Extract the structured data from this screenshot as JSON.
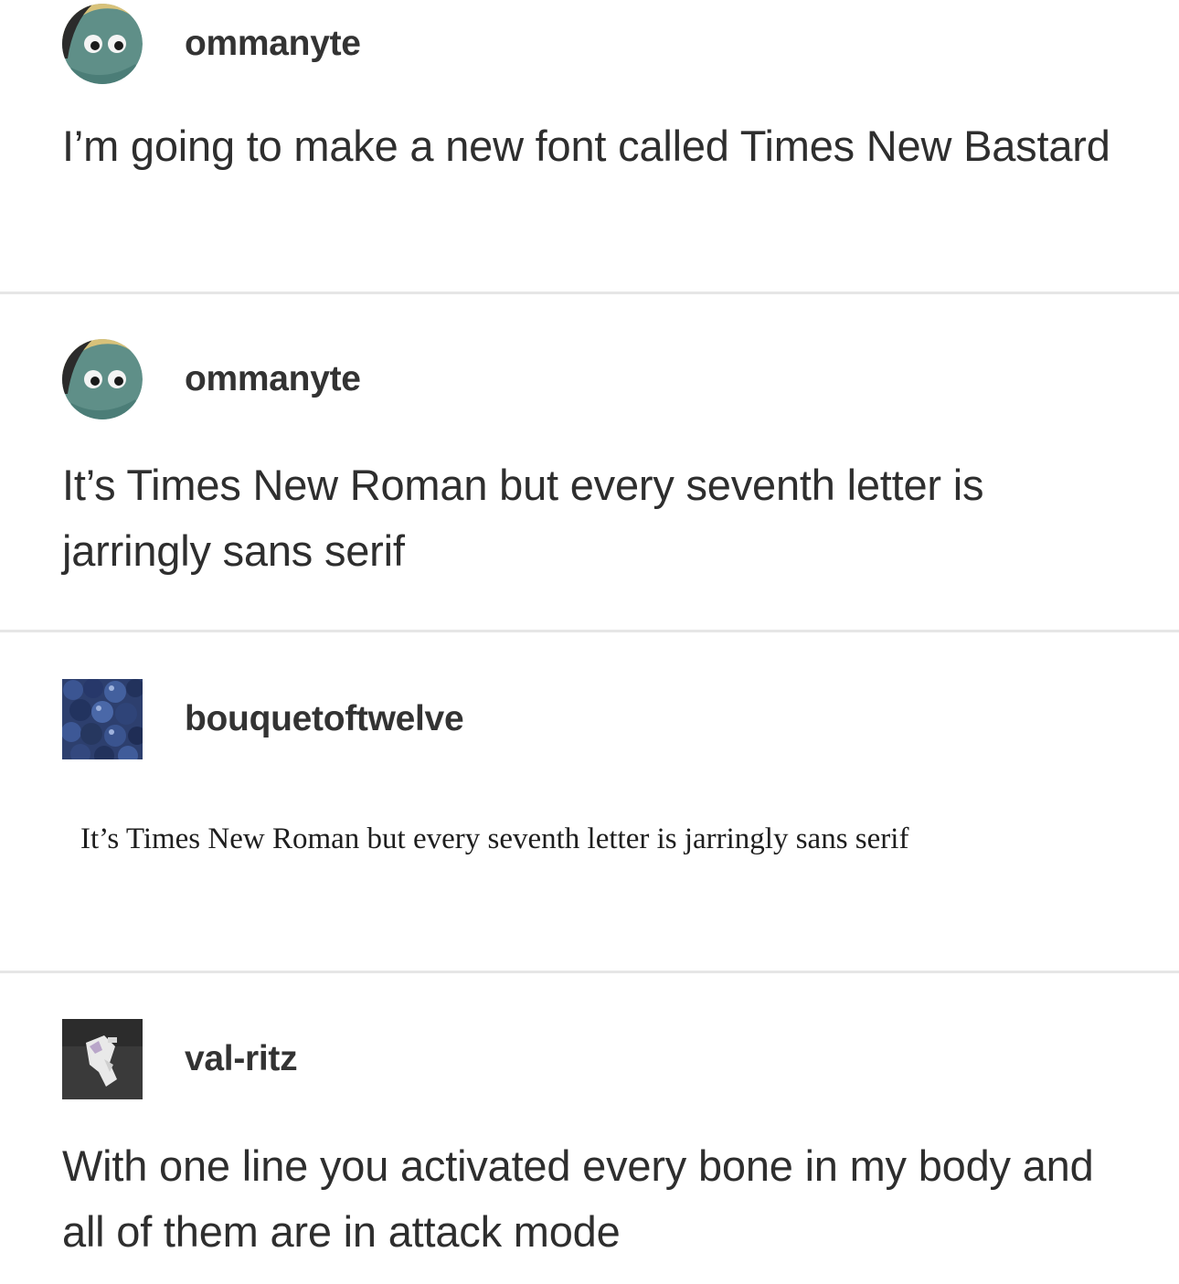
{
  "posts": [
    {
      "username": "ommanyte",
      "avatar_icon": "cartoon-creature-avatar",
      "text": "I’m going to make a new font called Times New Bastard"
    },
    {
      "username": "ommanyte",
      "avatar_icon": "cartoon-creature-avatar",
      "text": "It’s Times New Roman but every seventh letter is jarringly sans serif"
    },
    {
      "username": "bouquetoftwelve",
      "avatar_icon": "blueberries-avatar",
      "image_text": "It’s Times New Roman but every seventh letter is jarringly sans serif"
    },
    {
      "username": "val-ritz",
      "avatar_icon": "figure-avatar",
      "text": "With one line you activated every bone in my body and all of them are in attack mode"
    }
  ],
  "colors": {
    "background": "#ffffff",
    "text": "#2e2e2e",
    "username": "#333333",
    "divider": "#e6e6e6"
  }
}
